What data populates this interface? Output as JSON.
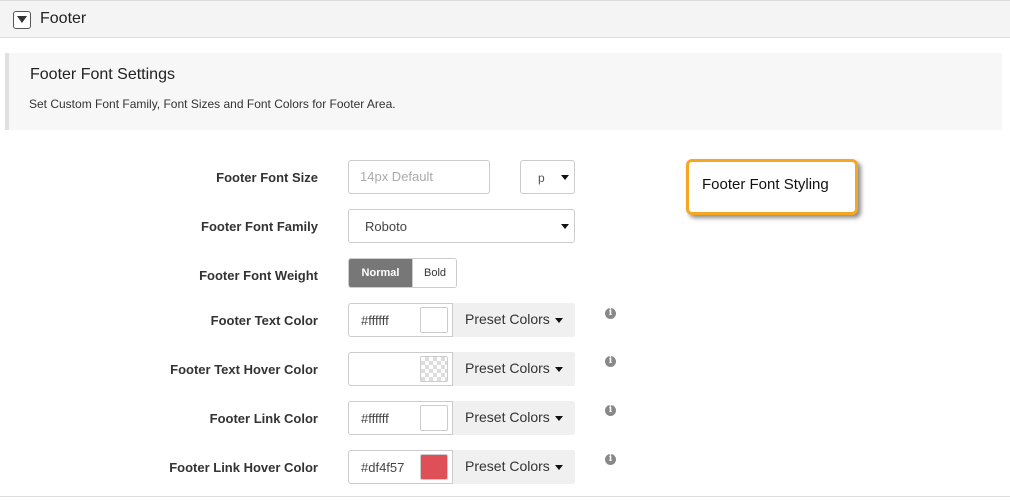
{
  "section": {
    "title": "Footer",
    "toggle_icon": "collapse-triangle-icon"
  },
  "description": {
    "title": "Footer Font Settings",
    "text": "Set Custom Font Family, Font Sizes and Font Colors for Footer Area."
  },
  "font_size": {
    "label": "Footer Font Size",
    "placeholder": "14px Default",
    "unit_value": "p"
  },
  "font_family": {
    "label": "Footer Font Family",
    "value": "Roboto"
  },
  "font_weight": {
    "label": "Footer Font Weight",
    "options": [
      "Normal",
      "Bold"
    ],
    "selected": "Normal"
  },
  "text_color": {
    "label": "Footer Text Color",
    "hex": "#ffffff",
    "swatch": "#ffffff",
    "preset_label": "Preset Colors"
  },
  "text_hover_color": {
    "label": "Footer Text Hover Color",
    "hex": "",
    "swatch": "transparent",
    "preset_label": "Preset Colors"
  },
  "link_color": {
    "label": "Footer Link Color",
    "hex": "#ffffff",
    "swatch": "#ffffff",
    "preset_label": "Preset Colors"
  },
  "link_hover_color": {
    "label": "Footer Link Hover Color",
    "hex": "#df4f57",
    "swatch": "#df4f57",
    "preset_label": "Preset Colors"
  },
  "info_glyph": "i",
  "callout": {
    "text": "Footer Font Styling",
    "border_color": "#f5a623"
  }
}
